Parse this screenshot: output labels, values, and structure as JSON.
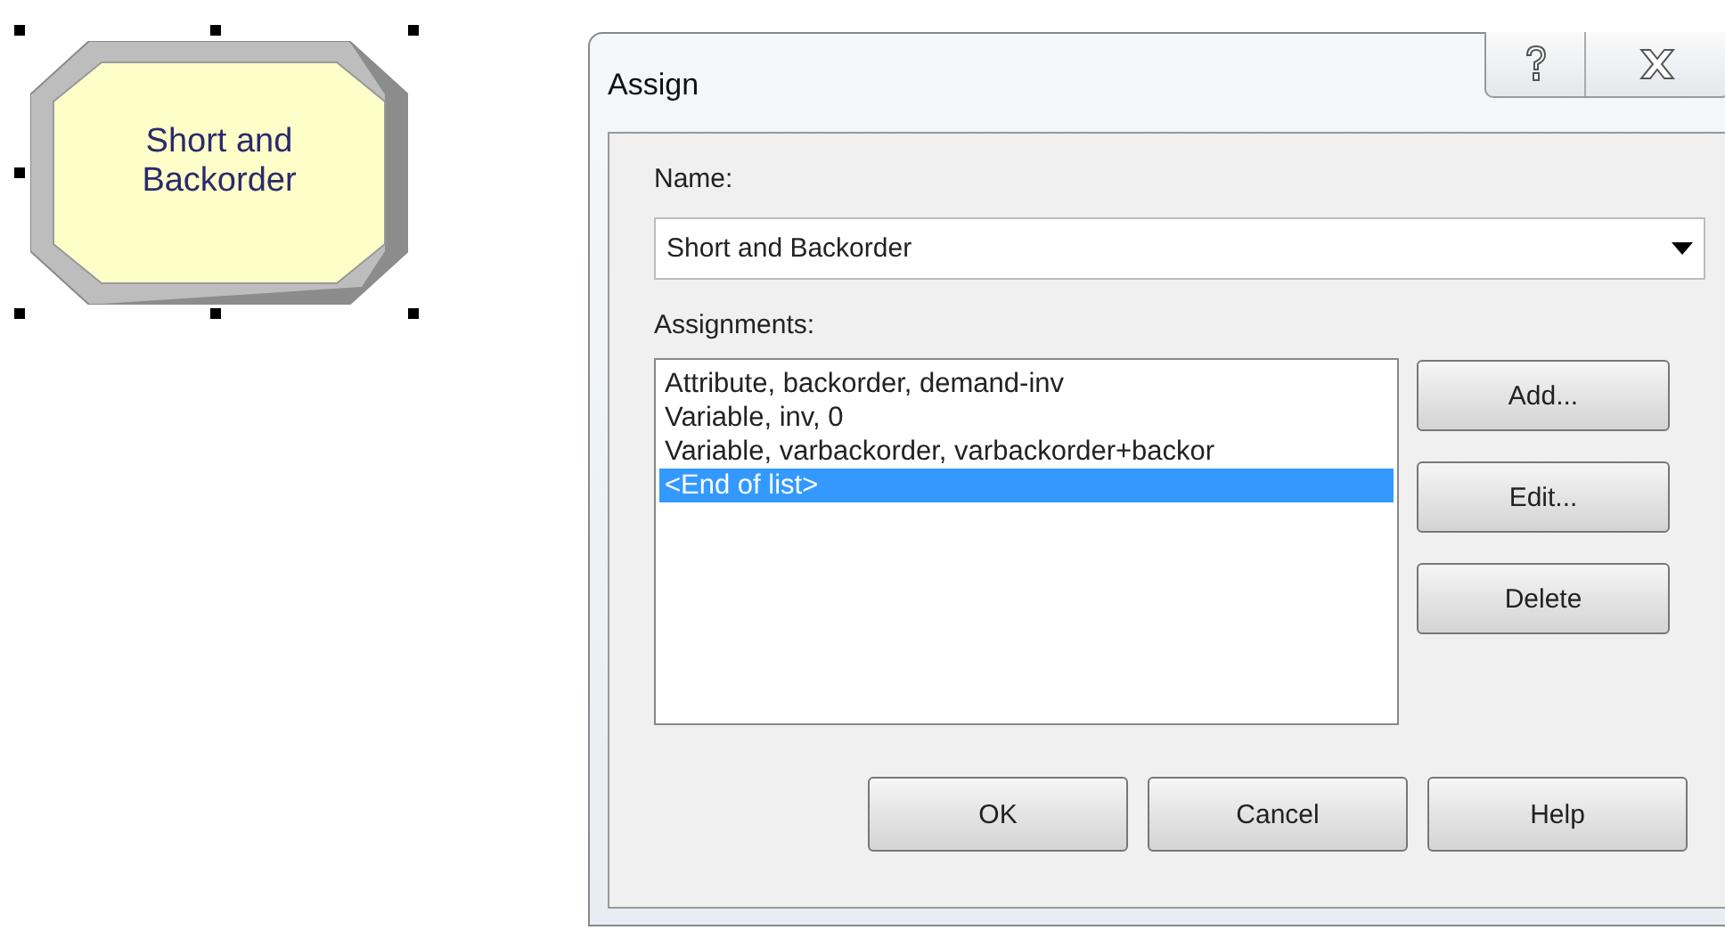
{
  "canvas": {
    "module": {
      "label": "Short and Backorder",
      "selected": true
    }
  },
  "dialog": {
    "title": "Assign",
    "name_label": "Name:",
    "name_value": "Short and Backorder",
    "assignments_label": "Assignments:",
    "assignments": [
      {
        "text": "Attribute, backorder, demand-inv",
        "selected": false
      },
      {
        "text": "Variable, inv, 0",
        "selected": false
      },
      {
        "text": "Variable, varbackorder, varbackorder+backor",
        "selected": false
      },
      {
        "text": "<End of list>",
        "selected": true
      }
    ],
    "side_buttons": [
      "Add...",
      "Edit...",
      "Delete"
    ],
    "buttons": [
      "OK",
      "Cancel",
      "Help"
    ]
  }
}
